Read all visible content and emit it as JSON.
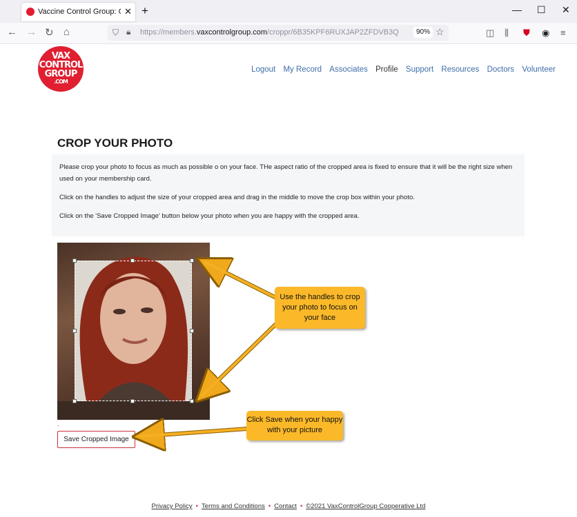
{
  "browser": {
    "tab_title": "Vaccine Control Group: Crop Ph",
    "tab_close": "✕",
    "new_tab": "+",
    "url_prefix": "https://members.",
    "url_host": "vaxcontrolgroup.com",
    "url_path": "/croppr/6B35KPF6RUXJAP2ZFDVB3Q",
    "zoom": "90%"
  },
  "logo": {
    "line1": "VAX",
    "line2": "CONTROL",
    "line3": "GROUP",
    "line4": ".COM"
  },
  "nav": [
    "Logout",
    "My Record",
    "Associates",
    "Profile",
    "Support",
    "Resources",
    "Doctors",
    "Volunteer"
  ],
  "nav_active": "Profile",
  "page": {
    "title": "CROP YOUR PHOTO",
    "instructions": [
      "Please crop your photo to focus as much as possible o on your face. THe aspect ratio of the cropped area is fixed to ensure that it will be the right size when used on your membership card.",
      "Click on the handles to adjust the size of your cropped area and drag in the middle to move the crop box within your photo.",
      "Click on the 'Save Cropped Image' button below your photo when you are happy with the cropped area."
    ],
    "dot": ".",
    "save_button": "Save Cropped Image"
  },
  "callouts": {
    "handles": "Use the handles to crop your photo to focus on your face",
    "save": "Click Save when your happy with your picture"
  },
  "footer": {
    "links": [
      "Privacy Policy",
      "Terms and Conditions",
      "Contact",
      "©2021 VaxControlGroup Cooperative Ltd"
    ],
    "separator": "•"
  },
  "colors": {
    "accent_red": "#e01f30",
    "nav_link": "#3f6ea8",
    "callout": "#fbb929",
    "button_border": "#c9303b"
  }
}
